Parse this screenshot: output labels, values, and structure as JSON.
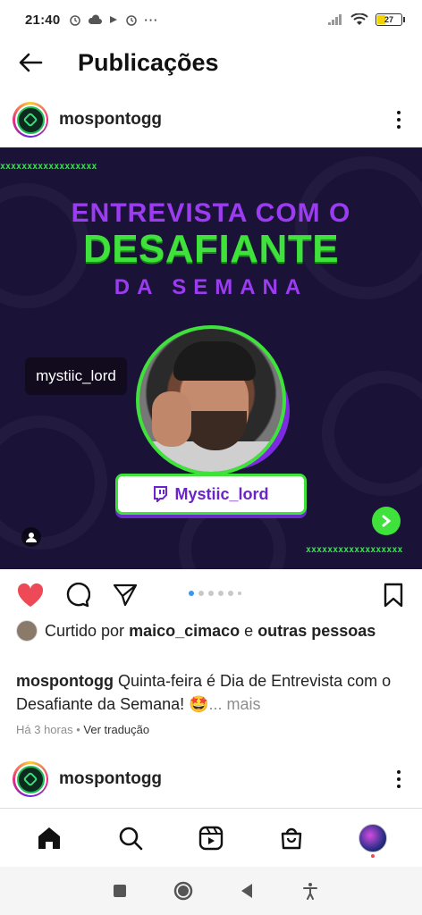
{
  "status_bar": {
    "time": "21:40",
    "left_icons": [
      "alarm-icon",
      "cloud-icon",
      "play-icon",
      "alarm-icon",
      "more-icon"
    ],
    "battery": "27"
  },
  "header": {
    "title": "Publicações"
  },
  "post": {
    "username": "mospontogg",
    "image": {
      "xmark_row": "xxxxxxxxxxxxxxxxxx",
      "title_line1": "ENTREVISTA COM O",
      "title_line2": "DESAFIANTE",
      "title_line3": "DA SEMANA",
      "name_pill": "Mystiic_lord",
      "user_tag": "mystiic_lord",
      "colors": {
        "purple": "#9b3cf0",
        "green": "#3ee23a",
        "background": "#1b1238"
      }
    },
    "carousel": {
      "count": 6,
      "active_index": 0
    },
    "likes": {
      "prefix": "Curtido por",
      "user": "maico_cimaco",
      "conjunction": "e",
      "others": "outras pessoas"
    },
    "caption": {
      "username": "mospontogg",
      "text": "Quinta-feira é Dia de Entrevista com o Desafiante da Semana! 🤩",
      "more": "... mais"
    },
    "meta": {
      "time": "Há 3 horas",
      "separator": "•",
      "translate": "Ver tradução"
    }
  },
  "next_post": {
    "username": "mospontogg"
  },
  "bottom_nav": {
    "items": [
      "home-icon",
      "search-icon",
      "reels-icon",
      "shop-icon",
      "profile-avatar"
    ],
    "active": "home-icon"
  },
  "system_nav": {
    "items": [
      "recent-apps-icon",
      "home-circle-icon",
      "back-triangle-icon",
      "accessibility-icon"
    ]
  }
}
